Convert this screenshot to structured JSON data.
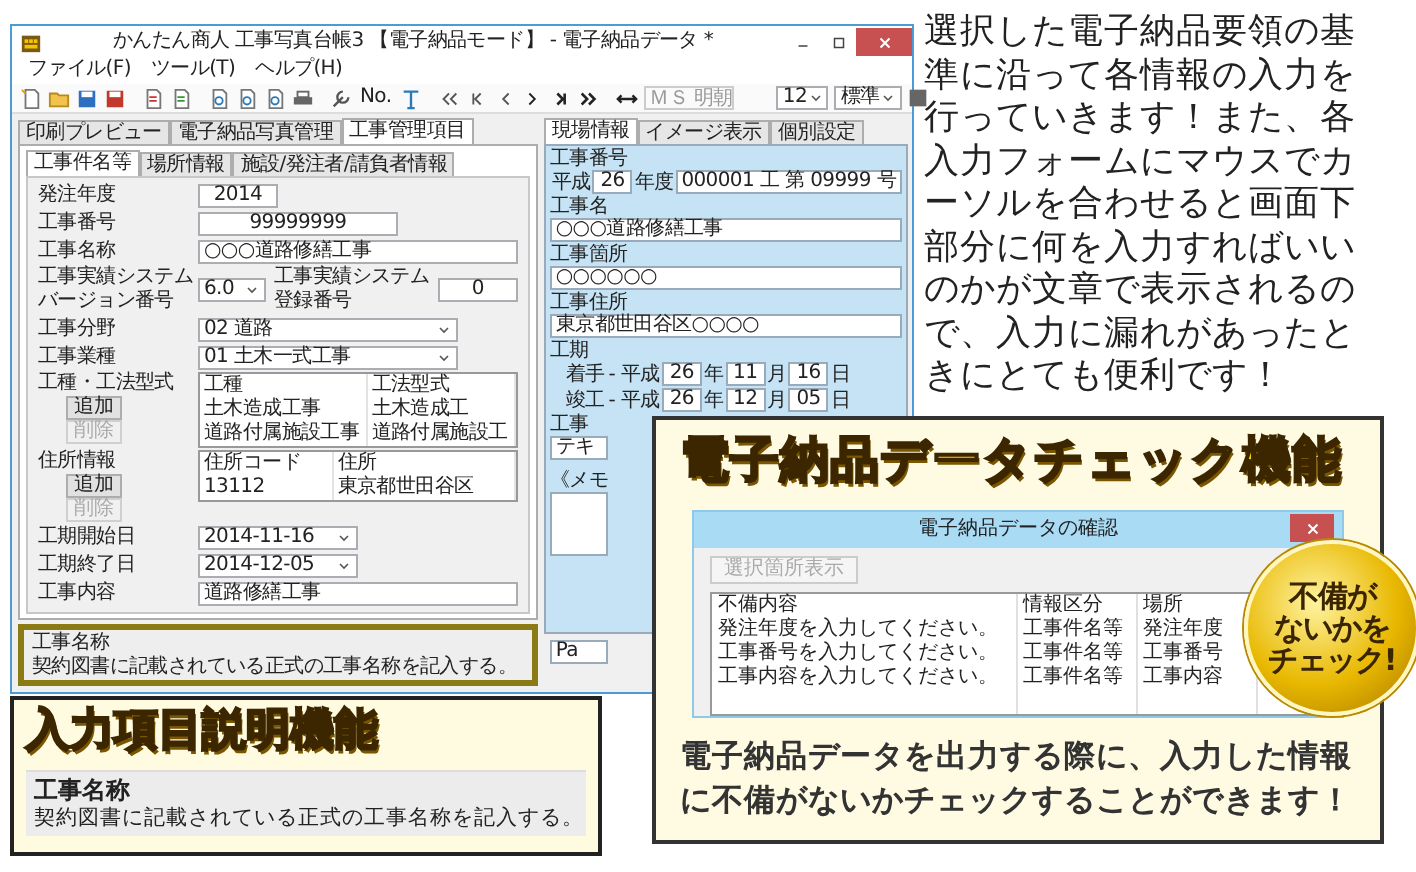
{
  "window": {
    "title": "かんたん商人 工事写真台帳3 【電子納品モード】 - 電子納品データ *"
  },
  "menu": [
    {
      "label": "ファイル(F)"
    },
    {
      "label": "ツール(T)"
    },
    {
      "label": "ヘルプ(H)"
    }
  ],
  "toolbar": {
    "number_label": "No.",
    "font": "ＭＳ 明朝",
    "size": "12",
    "style": "標準"
  },
  "tabs": [
    {
      "label": "印刷プレビュー",
      "selected": false
    },
    {
      "label": "電子納品写真管理",
      "selected": false
    },
    {
      "label": "工事管理項目",
      "selected": true
    }
  ],
  "subtabs": [
    {
      "label": "工事件名等",
      "selected": true
    },
    {
      "label": "場所情報",
      "selected": false
    },
    {
      "label": "施設/発注者/請負者情報",
      "selected": false
    }
  ],
  "form": [
    {
      "kind": "year",
      "label": "発注年度",
      "value": "2014"
    },
    {
      "kind": "code",
      "label": "工事番号",
      "value": "99999999"
    },
    {
      "kind": "text",
      "label": "工事名称",
      "value": "○○○道路修繕工事"
    },
    {
      "kind": "system",
      "label": "工事実績システムバージョン番号",
      "value": "6.0",
      "label2": "工事実績システム登録番号",
      "value2": "0"
    },
    {
      "kind": "select",
      "label": "工事分野",
      "value": "02 道路"
    },
    {
      "kind": "select",
      "label": "工事業種",
      "value": "01 土木一式工事"
    },
    {
      "kind": "grid",
      "label": "工種・工法型式",
      "buttons": [
        {
          "label": "追加",
          "disabled": false
        },
        {
          "label": "削除",
          "disabled": true
        }
      ],
      "columns": [
        "工種",
        "工法型式"
      ],
      "rows": [
        [
          "土木造成工事",
          "土木造成工"
        ],
        [
          "道路付属施設工事",
          "道路付属施設工"
        ]
      ]
    },
    {
      "kind": "grid",
      "label": "住所情報",
      "buttons": [
        {
          "label": "追加",
          "disabled": false
        },
        {
          "label": "削除",
          "disabled": true
        }
      ],
      "columns": [
        "住所コード",
        "住所"
      ],
      "rows": [
        [
          "13112",
          "東京都世田谷区"
        ]
      ]
    },
    {
      "kind": "date",
      "label": "工期開始日",
      "value": "2014-11-16"
    },
    {
      "kind": "date",
      "label": "工期終了日",
      "value": "2014-12-05"
    },
    {
      "kind": "text",
      "label": "工事内容",
      "value": "道路修繕工事"
    }
  ],
  "help": {
    "title": "工事名称",
    "text": "契約図書に記載されている正式の工事名称を記入する。"
  },
  "side": {
    "tabs": [
      {
        "label": "現場情報",
        "selected": true
      },
      {
        "label": "イメージ表示",
        "selected": false
      },
      {
        "label": "個別設定",
        "selected": false
      }
    ],
    "number": {
      "label": "工事番号",
      "era": "平成",
      "year": "26",
      "year_unit": "年度",
      "value": "000001 工 第 09999 号"
    },
    "fields": [
      {
        "label": "工事名",
        "value": "○○○道路修繕工事"
      },
      {
        "label": "工事箇所",
        "value": "○○○○○○"
      },
      {
        "label": "工事住所",
        "value": "東京都世田谷区○○○○"
      }
    ],
    "period": {
      "label": "工期",
      "rows": [
        {
          "label": "着手",
          "era": "- 平成",
          "year": "26",
          "year_unit": "年",
          "month": "11",
          "month_unit": "月",
          "day": "16",
          "day_unit": "日"
        },
        {
          "label": "竣工",
          "era": "- 平成",
          "year": "26",
          "year_unit": "年",
          "month": "12",
          "month_unit": "月",
          "day": "05",
          "day_unit": "日"
        }
      ]
    },
    "covered_label": "工事",
    "covered_value": "テキ",
    "memo_label": "《メモ",
    "page_value": "Pa"
  },
  "check": {
    "title": "電子納品データチェック機能",
    "dialog": {
      "title": "電子納品データの確認",
      "button": "選択箇所表示",
      "columns": [
        "不備内容",
        "情報区分",
        "場所"
      ],
      "rows": [
        [
          "発注年度を入力してください。",
          "工事件名等",
          "発注年度"
        ],
        [
          "工事番号を入力してください。",
          "工事件名等",
          "工事番号"
        ],
        [
          "工事内容を入力してください。",
          "工事件名等",
          "工事内容"
        ]
      ]
    },
    "badge_lines": [
      "不備が",
      "ないかを",
      "チェック!"
    ],
    "caption": "電子納品データを出力する際に、入力した情報に不備がないかチェックすることができます！"
  },
  "explain": {
    "title": "入力項目説明機能",
    "heading": "工事名称",
    "text": "契約図書に記載されている正式の工事名称を記入する。"
  },
  "description": "選択した電子納品要領の基準に沿って各情報の入力を行っていきます！また、各入力フォームにマウスでカーソルを合わせると画面下部分に何を入力すればいいのかが文章で表示されるので、入力に漏れがあったときにとても便利です！"
}
